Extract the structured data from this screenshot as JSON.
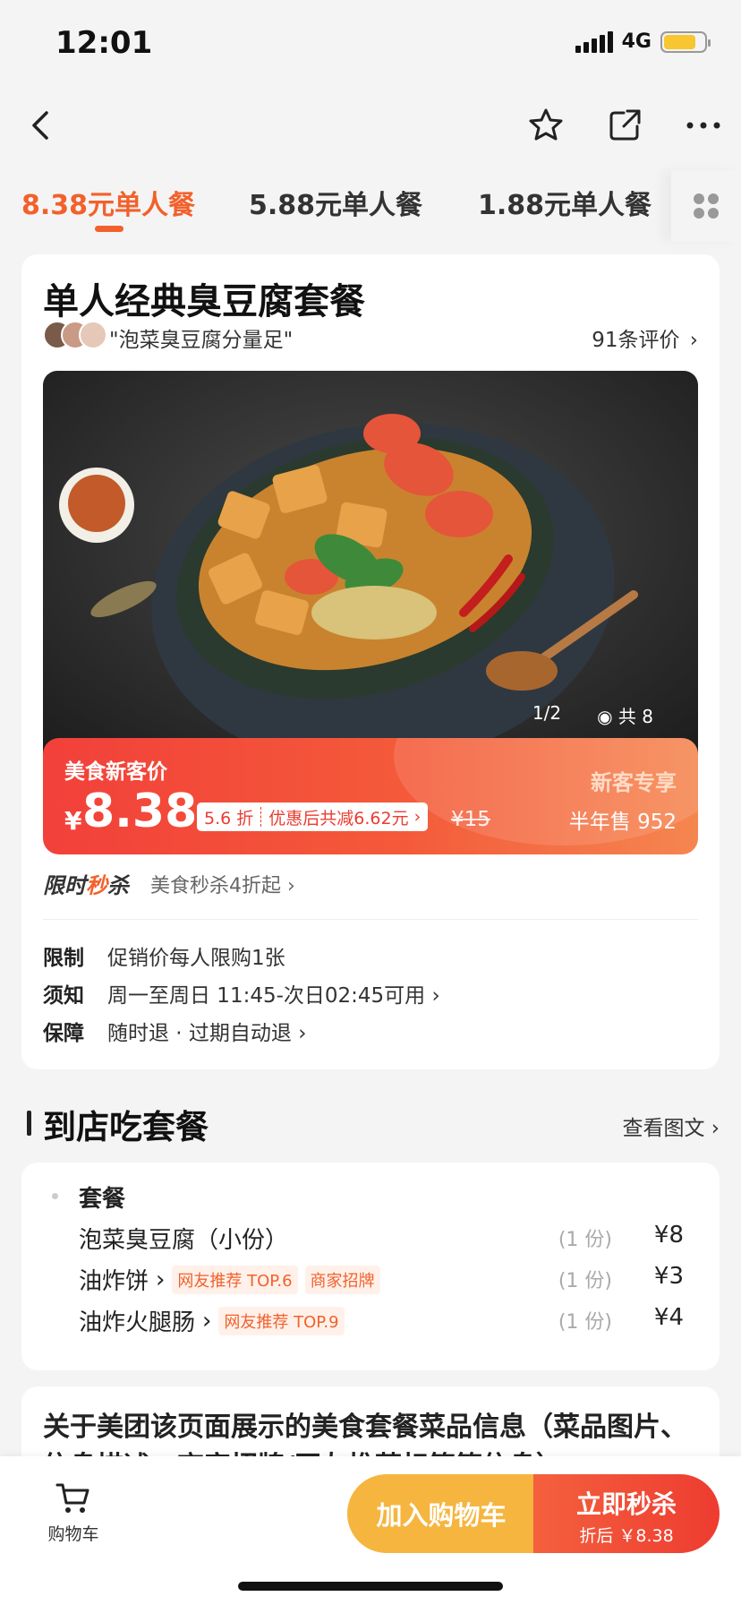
{
  "status_bar": {
    "time": "12:01",
    "network": "4G"
  },
  "tabs": [
    {
      "label": "8.38元单人餐"
    },
    {
      "label": "5.88元单人餐"
    },
    {
      "label": "1.88元单人餐"
    }
  ],
  "product": {
    "title": "单人经典臭豆腐套餐",
    "quote": "\"泡菜臭豆腐分量足\"",
    "reviews": "91条评价",
    "photo_index": "1/2",
    "photo_total": "共 8"
  },
  "promo": {
    "label": "美食新客价",
    "currency": "¥",
    "price": "8.38",
    "discount": "5.6 折",
    "saving": "优惠后共减6.62元",
    "original": "¥15",
    "new_customer": "新客专享",
    "sold": "半年售 952"
  },
  "flash_sale": {
    "logo_a": "限时",
    "logo_b": "秒",
    "logo_c": "杀",
    "text": "美食秒杀4折起"
  },
  "info": [
    {
      "key": "限制",
      "value": "促销价每人限购1张"
    },
    {
      "key": "须知",
      "value": "周一至周日 11:45-次日02:45可用"
    },
    {
      "key": "保障",
      "value": "随时退 · 过期自动退"
    }
  ],
  "section": {
    "title": "到店吃套餐",
    "link": "查看图文"
  },
  "package": {
    "title": "套餐",
    "items": [
      {
        "name": "泡菜臭豆腐（小份）",
        "qty": "(1 份)",
        "price": "¥8"
      },
      {
        "name": "油炸饼",
        "tag1": "网友推荐 TOP.6",
        "tag2": "商家招牌",
        "qty": "(1 份)",
        "price": "¥3"
      },
      {
        "name": "油炸火腿肠",
        "tag1": "网友推荐 TOP.9",
        "qty": "(1 份)",
        "price": "¥4"
      }
    ]
  },
  "disclaimer": "关于美团该页面展示的美食套餐菜品信息（菜品图片、信息描述、商家招牌/网友推荐标签等信息）",
  "bottom_bar": {
    "cart_label": "购物车",
    "add_cart": "加入购物车",
    "buy_now": "立即秒杀",
    "buy_sub": "折后 ￥8.38"
  },
  "colors": {
    "accent": "#f2612c",
    "promo_red": "#ee3c30",
    "cart_yellow": "#f6b53e"
  }
}
